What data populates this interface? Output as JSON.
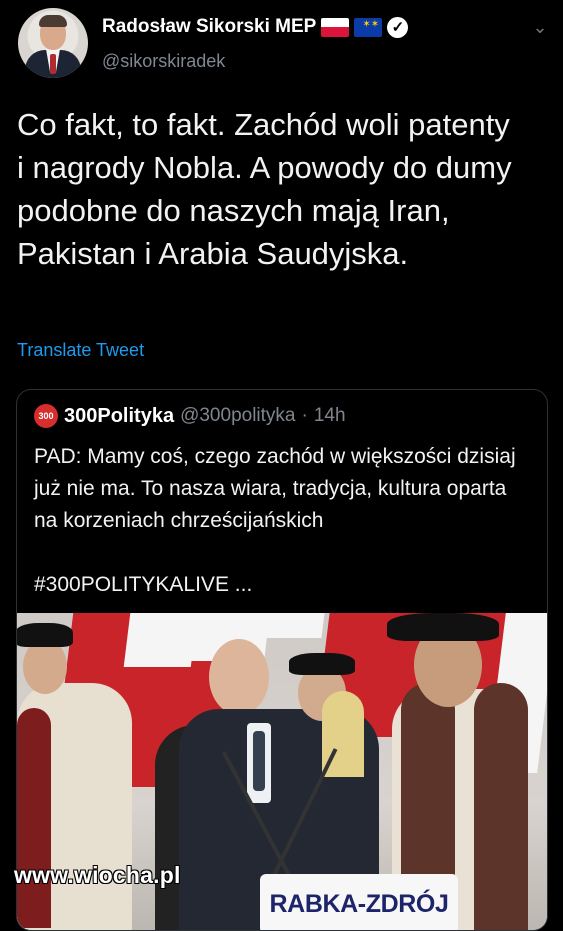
{
  "author": {
    "name": "Radosław Sikorski MEP",
    "handle": "@sikorskiradek",
    "verified_icon": "verified-badge",
    "flag_icons": [
      "poland-flag-icon",
      "eu-flag-icon"
    ]
  },
  "tweet": {
    "text": "Co fakt, to fakt. Zachód woli patenty i nagrody Nobla. A powody do dumy podobne do naszych mają Iran, Pakistan i Arabia Saudyjska.",
    "translate_label": "Translate Tweet"
  },
  "quoted_tweet": {
    "name": "300Polityka",
    "handle": "@300polityka",
    "separator": "·",
    "time": "14h",
    "text": "PAD: Mamy coś, czego zachód w większości dzisiaj już nie ma. To nasza wiara, tradycja, kultura oparta na korzeniach chrześcijańskich\n\n#300POLITYKALIVE ...",
    "image": {
      "podium_text": "RABKA-ZDRÓJ"
    }
  },
  "watermark": "www.wiocha.pl",
  "colors": {
    "background": "#000000",
    "link": "#1d9bf0",
    "muted": "#80868d",
    "border": "#2c3238"
  }
}
